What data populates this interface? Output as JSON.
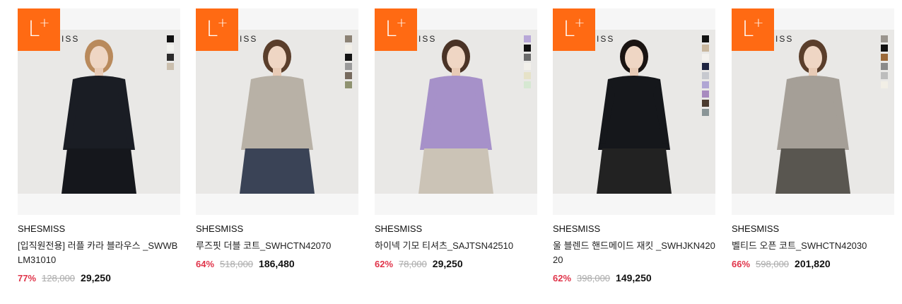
{
  "badge": {
    "main": "L",
    "sup": "+"
  },
  "image_brand_text": "ISS",
  "products": [
    {
      "brand": "SHESMISS",
      "name": "[입직원전용] 러플 카라 블라우스 _SWWBLM31010",
      "discount": "77%",
      "original_price": "128,000",
      "price": "29,250",
      "swatches": [
        "#111111",
        "#f3f3ef",
        "#2b2b2b",
        "#cbbfae"
      ],
      "garment_color": "#1a1d24",
      "bottom_color": "#15171c",
      "hair_color": "#b98a5c"
    },
    {
      "brand": "SHESMISS",
      "name": "루즈핏 더블 코트_SWHCTN42070",
      "discount": "64%",
      "original_price": "518,000",
      "price": "186,480",
      "swatches": [
        "#8c8275",
        "#f2efe8",
        "#131313",
        "#9a9a9a",
        "#766a5e",
        "#8f9270"
      ],
      "garment_color": "#b8b1a6",
      "bottom_color": "#3a4356",
      "hair_color": "#5a3e2b"
    },
    {
      "brand": "SHESMISS",
      "name": "하이넥 기모 티셔츠_SAJTSN42510",
      "discount": "62%",
      "original_price": "78,000",
      "price": "29,250",
      "swatches": [
        "#b8a8d8",
        "#111111",
        "#6b6b6b",
        "#f2f0ea",
        "#e6e2c8",
        "#d6e8d2"
      ],
      "garment_color": "#a691c9",
      "bottom_color": "#cbc3b6",
      "hair_color": "#4a3326"
    },
    {
      "brand": "SHESMISS",
      "name": "울 블렌드 핸드메이드 재킷 _SWHJKN42020",
      "discount": "62%",
      "original_price": "398,000",
      "price": "149,250",
      "swatches": [
        "#111111",
        "#c9b79e",
        "#f4f2ee",
        "#1d2340",
        "#c7c9cf",
        "#b0a6d4",
        "#a88bbf",
        "#4a3b30",
        "#8a9597"
      ],
      "garment_color": "#15171b",
      "bottom_color": "#222222",
      "hair_color": "#1a1412"
    },
    {
      "brand": "SHESMISS",
      "name": "벨티드 오픈 코트_SWHCTN42030",
      "discount": "66%",
      "original_price": "598,000",
      "price": "201,820",
      "swatches": [
        "#9a958e",
        "#111111",
        "#9c6a3a",
        "#8a8a8a",
        "#bdbdbd",
        "#f2efe6"
      ],
      "garment_color": "#a59f97",
      "bottom_color": "#595650",
      "hair_color": "#5a3e2b"
    }
  ]
}
